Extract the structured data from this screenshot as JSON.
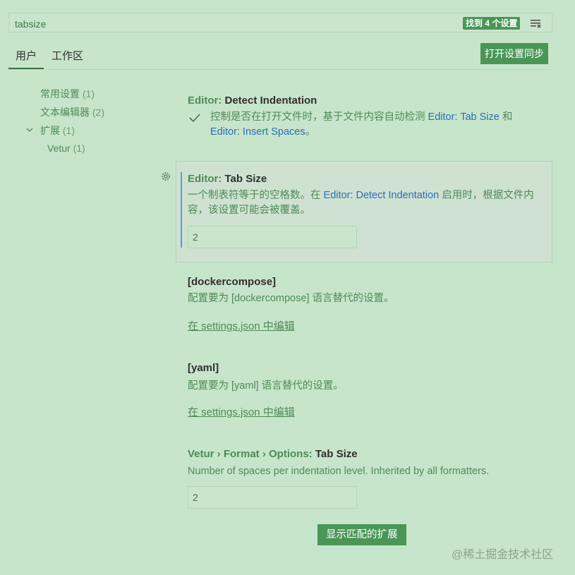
{
  "search": {
    "value": "tabsize",
    "result_badge": "找到 4 个设置"
  },
  "tabs": {
    "user": "用户",
    "workspace": "工作区"
  },
  "sync_button": "打开设置同步",
  "toc": {
    "common": {
      "label": "常用设置",
      "count": "(1)"
    },
    "editor": {
      "label": "文本编辑器",
      "count": "(2)"
    },
    "extensions": {
      "label": "扩展",
      "count": "(1)"
    },
    "vetur": {
      "label": "Vetur",
      "count": "(1)"
    }
  },
  "settings": {
    "detect_indentation": {
      "category": "Editor: ",
      "name": "Detect Indentation",
      "desc_a": "控制是否在打开文件时，基于文件内容自动检测 ",
      "link_a": "Editor: Tab Size",
      "desc_b": " 和 ",
      "link_b": "Editor: Insert Spaces",
      "desc_c": "。"
    },
    "tab_size": {
      "category": "Editor: ",
      "name": "Tab Size",
      "desc_a": "一个制表符等于的空格数。在 ",
      "link": "Editor: Detect Indentation",
      "desc_b": " 启用时，根据文件内容，该设置可能会被覆盖。",
      "value": "2"
    },
    "dockercompose": {
      "name": "[dockercompose]",
      "desc": "配置要为 [dockercompose] 语言替代的设置。",
      "link": "在 settings.json 中编辑"
    },
    "yaml": {
      "name": "[yaml]",
      "desc": "配置要为 [yaml] 语言替代的设置。",
      "link": "在 settings.json 中编辑"
    },
    "vetur_tab_size": {
      "category": "Vetur › Format › Options: ",
      "name": "Tab Size",
      "desc": "Number of spaces per indentation level. Inherited by all formatters.",
      "value": "2"
    }
  },
  "show_extensions_button": "显示匹配的扩展",
  "watermark": "@稀土掘金技术社区",
  "colors": {
    "background": "#c7e5cb",
    "accent": "#4a9656",
    "link": "#2b6db7",
    "modified_bar": "#5b9bd6"
  }
}
